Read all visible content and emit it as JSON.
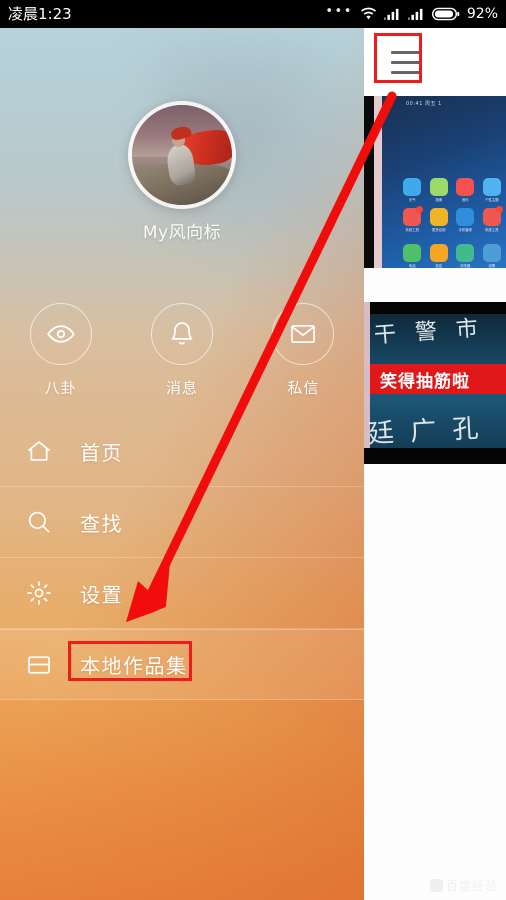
{
  "status_bar": {
    "time": "凌晨1:23",
    "dots": "•••",
    "wifi_icon": "wifi-icon",
    "signal1_icon": "signal-bars-icon",
    "signal2_icon": "signal-bars-icon",
    "battery_icon": "battery-icon",
    "battery_percent": "92%"
  },
  "app": {
    "menu_button_icon": "hamburger-menu-icon",
    "thumbnails": [
      {
        "name": "home-screen-thumbnail",
        "status_time": "00:41 周五 1",
        "app_icons": [
          {
            "label": "天气",
            "color": "#3fa9ec"
          },
          {
            "label": "相册",
            "color": "#9bd96a"
          },
          {
            "label": "音乐",
            "color": "#f2514f"
          },
          {
            "label": "个性主题",
            "color": "#4fb3f0"
          },
          {
            "label": "系统工具",
            "color": "#f0584f"
          },
          {
            "label": "更多应用",
            "color": "#f0b429"
          },
          {
            "label": "手机管家",
            "color": "#2f8fdc"
          },
          {
            "label": "系统工具",
            "color": "#f0584f"
          },
          {
            "label": "电话",
            "color": "#4fc06a"
          },
          {
            "label": "信息",
            "color": "#f5a623"
          },
          {
            "label": "浏览器",
            "color": "#43b98f"
          },
          {
            "label": "设置",
            "color": "#4e9ed6"
          }
        ]
      },
      {
        "name": "video-thumbnail",
        "banner_text": "笑得抽筋啦",
        "bg_chars_top": "干 警 市",
        "bg_chars_bottom": "廷 广 孔"
      }
    ],
    "watermark": "百度经验"
  },
  "drawer": {
    "avatar_icon": "user-avatar-photo",
    "username": "My风向标",
    "quick_actions": [
      {
        "icon": "eye-icon",
        "label": "八卦"
      },
      {
        "icon": "bell-icon",
        "label": "消息"
      },
      {
        "icon": "envelope-icon",
        "label": "私信"
      }
    ],
    "menu_items": [
      {
        "icon": "home-icon",
        "label": "首页",
        "active": false
      },
      {
        "icon": "search-icon",
        "label": "查找",
        "active": false
      },
      {
        "icon": "gear-icon",
        "label": "设置",
        "active": false
      },
      {
        "icon": "folder-icon",
        "label": "本地作品集",
        "active": true
      }
    ]
  },
  "annotations": {
    "highlight_color": "#ee1c1c",
    "arrow_color": "#f20d0d",
    "menu_button_box": "hamburger-menu-highlight",
    "local_portfolio_box": "local-portfolio-highlight",
    "arrow": "red-pointer-arrow"
  }
}
